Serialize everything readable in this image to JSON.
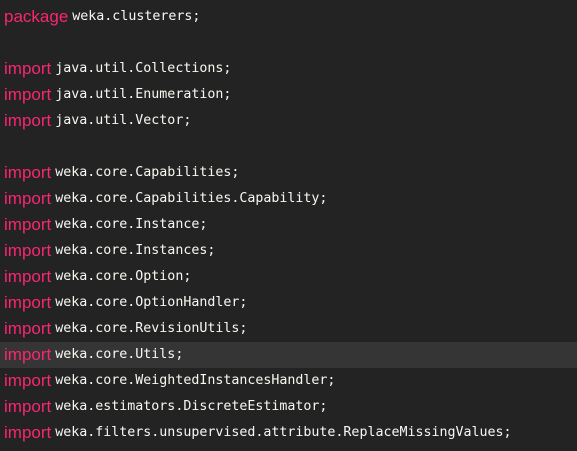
{
  "editor": {
    "colors": {
      "background": "#232323",
      "keyword": "#f92672",
      "text": "#f8f8f2",
      "current_line": "#353535"
    },
    "lines": [
      {
        "keyword": "package",
        "code": "weka.clusterers;"
      },
      {
        "keyword": "",
        "code": ""
      },
      {
        "keyword": "import",
        "code": "java.util.Collections;"
      },
      {
        "keyword": "import",
        "code": "java.util.Enumeration;"
      },
      {
        "keyword": "import",
        "code": "java.util.Vector;"
      },
      {
        "keyword": "",
        "code": ""
      },
      {
        "keyword": "import",
        "code": "weka.core.Capabilities;"
      },
      {
        "keyword": "import",
        "code": "weka.core.Capabilities.Capability;"
      },
      {
        "keyword": "import",
        "code": "weka.core.Instance;"
      },
      {
        "keyword": "import",
        "code": "weka.core.Instances;"
      },
      {
        "keyword": "import",
        "code": "weka.core.Option;"
      },
      {
        "keyword": "import",
        "code": "weka.core.OptionHandler;"
      },
      {
        "keyword": "import",
        "code": "weka.core.RevisionUtils;"
      },
      {
        "keyword": "import",
        "code": "weka.core.Utils;"
      },
      {
        "keyword": "import",
        "code": "weka.core.WeightedInstancesHandler;"
      },
      {
        "keyword": "import",
        "code": "weka.estimators.DiscreteEstimator;"
      },
      {
        "keyword": "import",
        "code": "weka.filters.unsupervised.attribute.ReplaceMissingValues;"
      }
    ]
  }
}
